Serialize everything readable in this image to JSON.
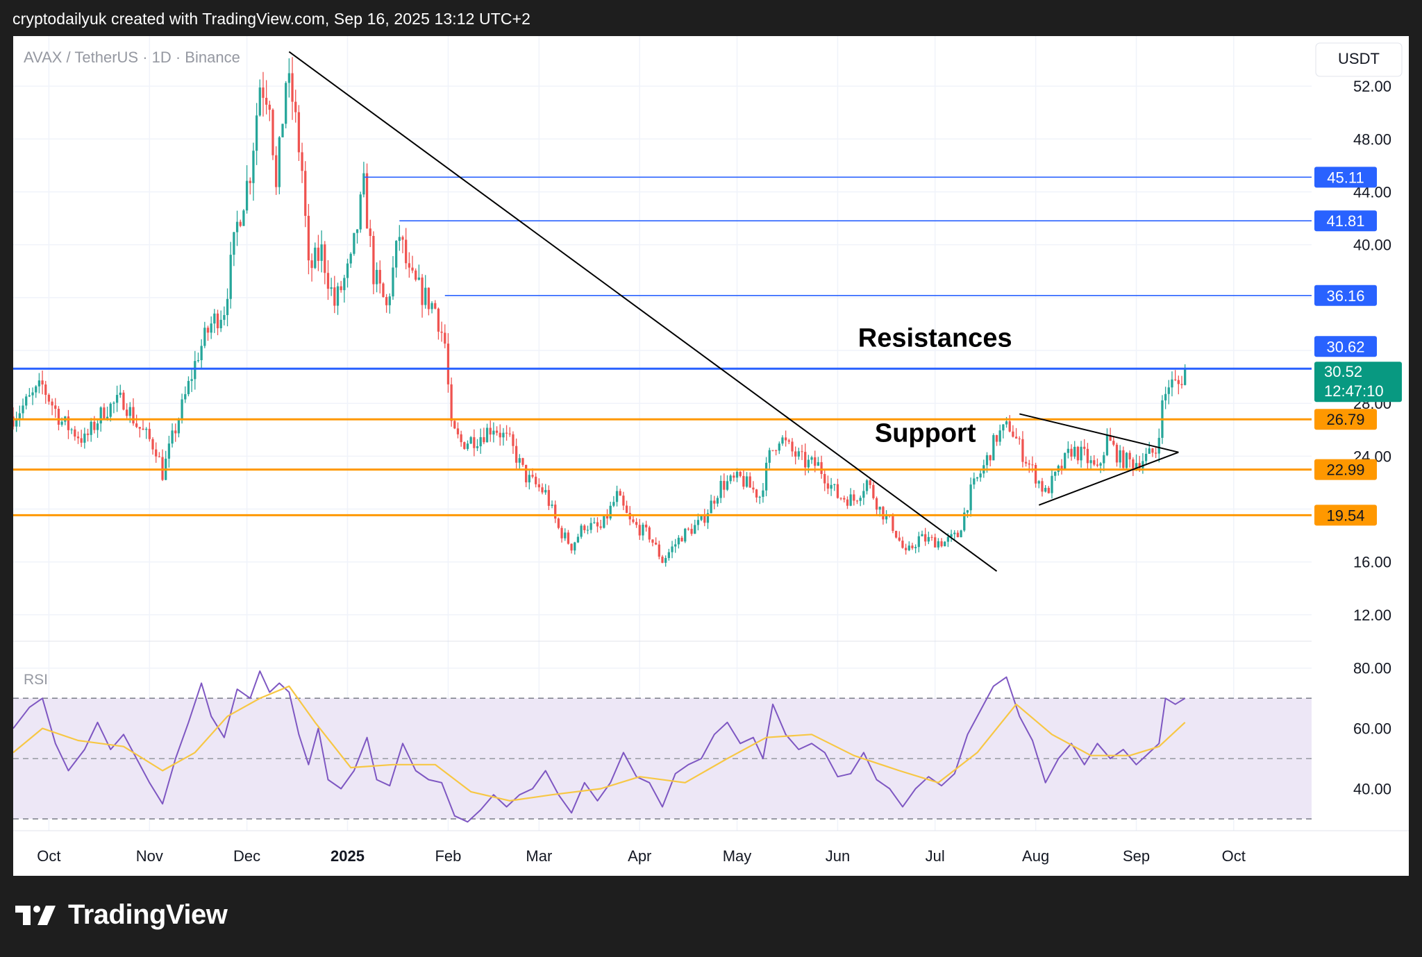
{
  "header": {
    "caption": "cryptodailyuk created with TradingView.com, Sep 16, 2025 13:12 UTC+2"
  },
  "brand": {
    "name": "TradingView",
    "logo_icon": "tradingview-logo-icon"
  },
  "colors": {
    "up_candle": "#26a69a",
    "down_candle": "#ef5350",
    "resistance_line": "#2962ff",
    "support_line": "#ff9800",
    "trend_line": "#000000",
    "rsi_line": "#7e57c2",
    "rsi_ma_line": "#f7c744",
    "rsi_band_fill": "#ede7f6",
    "current_price_badge": "#089981"
  },
  "chart_data": [
    {
      "type": "candlestick",
      "symbol_label": "AVAX / TetherUS · 1D · Binance",
      "currency_label": "USDT",
      "x_tick_labels": [
        "Oct",
        "Nov",
        "Dec",
        "2025",
        "Feb",
        "Mar",
        "Apr",
        "May",
        "Jun",
        "Jul",
        "Aug",
        "Sep",
        "Oct"
      ],
      "x_range": [
        "2024-09-20",
        "2025-10-25"
      ],
      "y_range": [
        10,
        55
      ],
      "y_tick_labels": [
        "52.00",
        "48.00",
        "44.00",
        "40.00",
        "16.00",
        "12.00"
      ],
      "y_tick_values": [
        52,
        48,
        44,
        40,
        16,
        12
      ],
      "y_ticks_partially_hidden": [
        {
          "value": 28,
          "label": "28.00"
        },
        {
          "value": 24,
          "label": "24.00"
        }
      ],
      "grid": true,
      "price_path": [
        [
          "2024-09-20",
          27.0
        ],
        [
          "2024-09-29",
          29.3
        ],
        [
          "2024-10-05",
          26.6
        ],
        [
          "2024-10-12",
          25.2
        ],
        [
          "2024-10-18",
          27.5
        ],
        [
          "2024-10-24",
          28.3
        ],
        [
          "2024-10-28",
          26.4
        ],
        [
          "2024-11-03",
          24.6
        ],
        [
          "2024-11-05",
          22.7
        ],
        [
          "2024-11-08",
          25.3
        ],
        [
          "2024-11-12",
          28.5
        ],
        [
          "2024-11-16",
          31.8
        ],
        [
          "2024-11-20",
          34.0
        ],
        [
          "2024-11-24",
          35.2
        ],
        [
          "2024-11-28",
          41.5
        ],
        [
          "2024-12-02",
          45.6
        ],
        [
          "2024-12-05",
          52.2
        ],
        [
          "2024-12-08",
          51.3
        ],
        [
          "2024-12-10",
          44.0
        ],
        [
          "2024-12-13",
          52.5
        ],
        [
          "2024-12-15",
          51.0
        ],
        [
          "2024-12-18",
          45.6
        ],
        [
          "2024-12-20",
          38.0
        ],
        [
          "2024-12-24",
          39.5
        ],
        [
          "2024-12-28",
          35.5
        ],
        [
          "2025-01-02",
          38.5
        ],
        [
          "2025-01-06",
          44.3
        ],
        [
          "2025-01-09",
          37.8
        ],
        [
          "2025-01-13",
          35.2
        ],
        [
          "2025-01-17",
          40.8
        ],
        [
          "2025-01-20",
          37.5
        ],
        [
          "2025-01-25",
          36.0
        ],
        [
          "2025-01-28",
          35.2
        ],
        [
          "2025-01-31",
          32.5
        ],
        [
          "2025-02-02",
          26.0
        ],
        [
          "2025-02-05",
          25.0
        ],
        [
          "2025-02-10",
          25.4
        ],
        [
          "2025-02-15",
          26.3
        ],
        [
          "2025-02-20",
          25.0
        ],
        [
          "2025-02-25",
          22.4
        ],
        [
          "2025-03-03",
          21.2
        ],
        [
          "2025-03-07",
          18.5
        ],
        [
          "2025-03-11",
          17.2
        ],
        [
          "2025-03-15",
          18.8
        ],
        [
          "2025-03-20",
          18.5
        ],
        [
          "2025-03-25",
          21.0
        ],
        [
          "2025-03-29",
          19.0
        ],
        [
          "2025-04-04",
          18.0
        ],
        [
          "2025-04-08",
          16.1
        ],
        [
          "2025-04-14",
          18.0
        ],
        [
          "2025-04-20",
          19.0
        ],
        [
          "2025-04-26",
          21.8
        ],
        [
          "2025-05-02",
          22.3
        ],
        [
          "2025-05-08",
          21.0
        ],
        [
          "2025-05-11",
          24.0
        ],
        [
          "2025-05-14",
          25.5
        ],
        [
          "2025-05-18",
          24.3
        ],
        [
          "2025-05-22",
          23.5
        ],
        [
          "2025-05-26",
          23.3
        ],
        [
          "2025-06-01",
          21.0
        ],
        [
          "2025-06-06",
          20.7
        ],
        [
          "2025-06-10",
          22.1
        ],
        [
          "2025-06-14",
          20.0
        ],
        [
          "2025-06-18",
          18.7
        ],
        [
          "2025-06-22",
          16.5
        ],
        [
          "2025-06-26",
          17.8
        ],
        [
          "2025-06-30",
          17.6
        ],
        [
          "2025-07-04",
          17.5
        ],
        [
          "2025-07-08",
          18.0
        ],
        [
          "2025-07-12",
          21.3
        ],
        [
          "2025-07-16",
          23.2
        ],
        [
          "2025-07-20",
          25.5
        ],
        [
          "2025-07-24",
          26.3
        ],
        [
          "2025-07-28",
          24.2
        ],
        [
          "2025-08-01",
          22.5
        ],
        [
          "2025-08-04",
          21.2
        ],
        [
          "2025-08-08",
          22.8
        ],
        [
          "2025-08-12",
          24.5
        ],
        [
          "2025-08-16",
          24.0
        ],
        [
          "2025-08-20",
          22.8
        ],
        [
          "2025-08-23",
          25.3
        ],
        [
          "2025-08-27",
          23.8
        ],
        [
          "2025-08-31",
          23.5
        ],
        [
          "2025-09-04",
          23.9
        ],
        [
          "2025-09-07",
          24.4
        ],
        [
          "2025-09-09",
          27.8
        ],
        [
          "2025-09-11",
          29.5
        ],
        [
          "2025-09-14",
          29.4
        ],
        [
          "2025-09-16",
          30.52
        ]
      ],
      "horizontal_levels": [
        {
          "role": "resistance",
          "value": 45.11,
          "label": "45.11",
          "from": "2025-01-06"
        },
        {
          "role": "resistance",
          "value": 41.81,
          "label": "41.81",
          "from": "2025-01-17"
        },
        {
          "role": "resistance",
          "value": 36.16,
          "label": "36.16",
          "from": "2025-01-31"
        },
        {
          "role": "resistance",
          "value": 30.62,
          "label": "30.62",
          "from": "start",
          "badge_offset_up": true
        },
        {
          "role": "support",
          "value": 26.79,
          "label": "26.79",
          "from": "start"
        },
        {
          "role": "support",
          "value": 22.99,
          "label": "22.99",
          "from": "start"
        },
        {
          "role": "support",
          "value": 19.54,
          "label": "19.54",
          "from": "start"
        }
      ],
      "current_price": {
        "value": 30.52,
        "label": "30.52",
        "countdown": "12:47:10"
      },
      "trendline": {
        "from": [
          "2024-12-14",
          54.6
        ],
        "to": [
          "2025-07-20",
          15.3
        ]
      },
      "triangle": {
        "upper": [
          [
            "2025-07-27",
            27.2
          ],
          [
            "2025-09-14",
            24.3
          ]
        ],
        "lower": [
          [
            "2025-08-02",
            20.3
          ],
          [
            "2025-09-14",
            24.3
          ]
        ]
      },
      "annotations": [
        {
          "text": "Resistances",
          "at": [
            "2025-07-01",
            32.3
          ]
        },
        {
          "text": "Support",
          "at": [
            "2025-06-28",
            25.1
          ]
        }
      ]
    },
    {
      "type": "line",
      "title": "RSI",
      "y_range": [
        30,
        82
      ],
      "y_tick_labels": [
        "80.00",
        "60.00",
        "40.00"
      ],
      "y_tick_values": [
        80,
        60,
        40
      ],
      "band": {
        "upper": 70,
        "middle": 50,
        "lower": 30
      },
      "series": [
        {
          "role": "rsi",
          "points": [
            [
              "2024-09-20",
              60
            ],
            [
              "2024-09-25",
              67
            ],
            [
              "2024-09-29",
              70
            ],
            [
              "2024-10-03",
              55
            ],
            [
              "2024-10-07",
              46
            ],
            [
              "2024-10-12",
              53
            ],
            [
              "2024-10-16",
              62
            ],
            [
              "2024-10-20",
              53
            ],
            [
              "2024-10-24",
              58
            ],
            [
              "2024-10-28",
              50
            ],
            [
              "2024-11-01",
              42
            ],
            [
              "2024-11-05",
              35
            ],
            [
              "2024-11-09",
              50
            ],
            [
              "2024-11-13",
              62
            ],
            [
              "2024-11-17",
              75
            ],
            [
              "2024-11-20",
              64
            ],
            [
              "2024-11-24",
              57
            ],
            [
              "2024-11-28",
              73
            ],
            [
              "2024-12-02",
              70
            ],
            [
              "2024-12-05",
              79
            ],
            [
              "2024-12-08",
              72
            ],
            [
              "2024-12-11",
              75
            ],
            [
              "2024-12-14",
              72
            ],
            [
              "2024-12-17",
              58
            ],
            [
              "2024-12-20",
              48
            ],
            [
              "2024-12-23",
              60
            ],
            [
              "2024-12-26",
              43
            ],
            [
              "2024-12-30",
              40
            ],
            [
              "2025-01-03",
              46
            ],
            [
              "2025-01-07",
              57
            ],
            [
              "2025-01-10",
              43
            ],
            [
              "2025-01-14",
              41
            ],
            [
              "2025-01-18",
              55
            ],
            [
              "2025-01-22",
              46
            ],
            [
              "2025-01-26",
              43
            ],
            [
              "2025-01-30",
              42
            ],
            [
              "2025-02-03",
              31
            ],
            [
              "2025-02-07",
              29
            ],
            [
              "2025-02-11",
              33
            ],
            [
              "2025-02-15",
              38
            ],
            [
              "2025-02-19",
              34
            ],
            [
              "2025-02-23",
              38
            ],
            [
              "2025-02-27",
              40
            ],
            [
              "2025-03-03",
              46
            ],
            [
              "2025-03-07",
              38
            ],
            [
              "2025-03-11",
              32
            ],
            [
              "2025-03-15",
              42
            ],
            [
              "2025-03-19",
              36
            ],
            [
              "2025-03-23",
              42
            ],
            [
              "2025-03-27",
              52
            ],
            [
              "2025-03-31",
              44
            ],
            [
              "2025-04-04",
              42
            ],
            [
              "2025-04-08",
              34
            ],
            [
              "2025-04-12",
              45
            ],
            [
              "2025-04-16",
              48
            ],
            [
              "2025-04-20",
              50
            ],
            [
              "2025-04-24",
              58
            ],
            [
              "2025-04-28",
              62
            ],
            [
              "2025-05-02",
              55
            ],
            [
              "2025-05-06",
              57
            ],
            [
              "2025-05-09",
              50
            ],
            [
              "2025-05-12",
              68
            ],
            [
              "2025-05-16",
              58
            ],
            [
              "2025-05-20",
              53
            ],
            [
              "2025-05-24",
              55
            ],
            [
              "2025-05-28",
              52
            ],
            [
              "2025-06-01",
              44
            ],
            [
              "2025-06-05",
              45
            ],
            [
              "2025-06-09",
              52
            ],
            [
              "2025-06-13",
              43
            ],
            [
              "2025-06-17",
              40
            ],
            [
              "2025-06-21",
              34
            ],
            [
              "2025-06-25",
              40
            ],
            [
              "2025-06-29",
              44
            ],
            [
              "2025-07-03",
              41
            ],
            [
              "2025-07-07",
              45
            ],
            [
              "2025-07-11",
              58
            ],
            [
              "2025-07-15",
              66
            ],
            [
              "2025-07-19",
              74
            ],
            [
              "2025-07-23",
              77
            ],
            [
              "2025-07-27",
              64
            ],
            [
              "2025-07-31",
              56
            ],
            [
              "2025-08-04",
              42
            ],
            [
              "2025-08-08",
              50
            ],
            [
              "2025-08-12",
              55
            ],
            [
              "2025-08-16",
              48
            ],
            [
              "2025-08-20",
              55
            ],
            [
              "2025-08-24",
              50
            ],
            [
              "2025-08-28",
              53
            ],
            [
              "2025-09-01",
              48
            ],
            [
              "2025-09-05",
              52
            ],
            [
              "2025-09-08",
              55
            ],
            [
              "2025-09-10",
              70
            ],
            [
              "2025-09-13",
              68
            ],
            [
              "2025-09-16",
              70
            ]
          ]
        },
        {
          "role": "rsi_ma",
          "points": [
            [
              "2024-09-20",
              52
            ],
            [
              "2024-09-29",
              60
            ],
            [
              "2024-10-10",
              56
            ],
            [
              "2024-10-24",
              54
            ],
            [
              "2024-11-05",
              46
            ],
            [
              "2024-11-15",
              52
            ],
            [
              "2024-11-25",
              64
            ],
            [
              "2024-12-05",
              70
            ],
            [
              "2024-12-14",
              74
            ],
            [
              "2024-12-22",
              62
            ],
            [
              "2025-01-02",
              47
            ],
            [
              "2025-01-15",
              48
            ],
            [
              "2025-01-28",
              48
            ],
            [
              "2025-02-08",
              39
            ],
            [
              "2025-02-20",
              36
            ],
            [
              "2025-03-05",
              38
            ],
            [
              "2025-03-20",
              40
            ],
            [
              "2025-04-01",
              44
            ],
            [
              "2025-04-15",
              42
            ],
            [
              "2025-04-28",
              50
            ],
            [
              "2025-05-10",
              57
            ],
            [
              "2025-05-24",
              58
            ],
            [
              "2025-06-06",
              51
            ],
            [
              "2025-06-20",
              46
            ],
            [
              "2025-07-02",
              42
            ],
            [
              "2025-07-14",
              52
            ],
            [
              "2025-07-26",
              68
            ],
            [
              "2025-08-06",
              58
            ],
            [
              "2025-08-18",
              51
            ],
            [
              "2025-08-30",
              51
            ],
            [
              "2025-09-08",
              54
            ],
            [
              "2025-09-16",
              62
            ]
          ]
        }
      ]
    }
  ]
}
